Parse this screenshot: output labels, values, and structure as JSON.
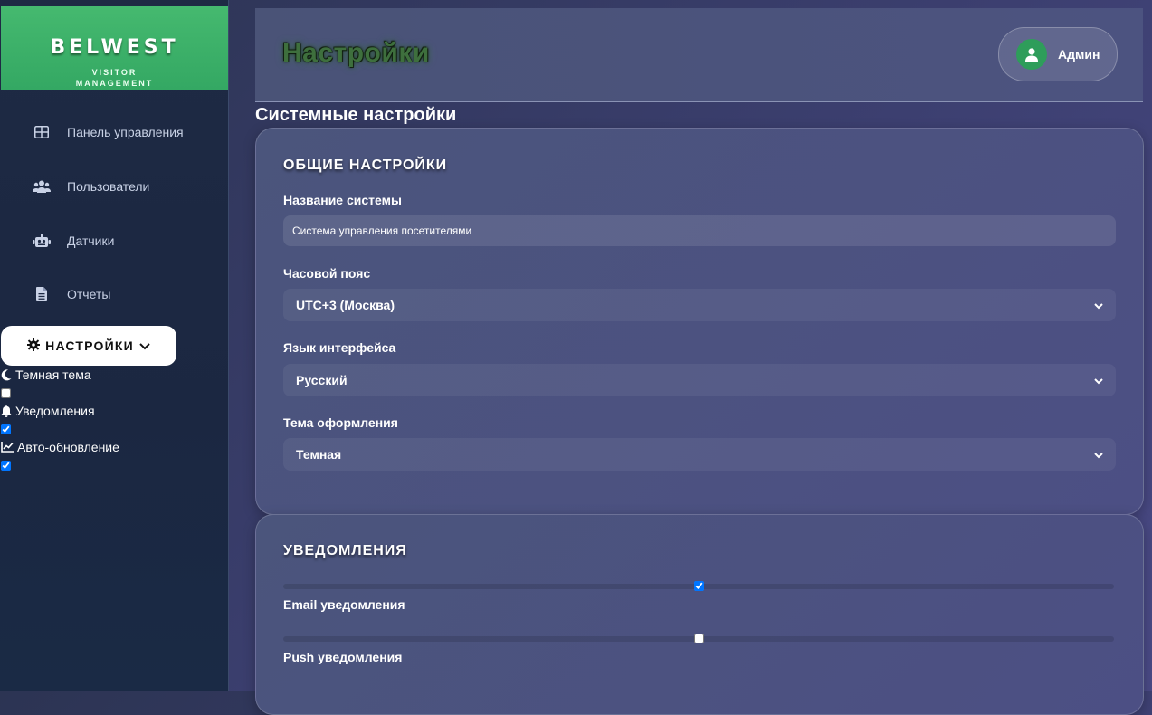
{
  "brand": {
    "title": "BELWEST",
    "sub1": "VISITOR",
    "sub2": "MANAGEMENT",
    "color": "#3fb56a"
  },
  "sidebar": {
    "items": [
      {
        "label": "Панель управления",
        "icon": "dashboard-icon"
      },
      {
        "label": "Пользователи",
        "icon": "users-icon"
      },
      {
        "label": "Датчики",
        "icon": "robot-icon"
      },
      {
        "label": "Отчеты",
        "icon": "document-icon"
      }
    ],
    "settings_label": "НАСТРОЙКИ",
    "options": [
      {
        "label": "Темная тема",
        "icon": "moon-icon",
        "checked": false
      },
      {
        "label": "Уведомления",
        "icon": "bell-icon",
        "checked": true
      },
      {
        "label": "Авто-обновление",
        "icon": "chart-line-icon",
        "checked": true
      }
    ]
  },
  "header": {
    "title": "Настройки",
    "user_name": "Админ"
  },
  "main": {
    "heading": "Системные настройки",
    "general": {
      "title": "ОБЩИЕ НАСТРОЙКИ",
      "system_name_label": "Название системы",
      "system_name_value": "Система управления посетителями",
      "timezone_label": "Часовой пояс",
      "timezone_value": "UTC+3 (Москва)",
      "language_label": "Язык интерфейса",
      "language_value": "Русский",
      "theme_label": "Тема оформления",
      "theme_value": "Темная"
    },
    "notifications": {
      "title": "УВЕДОМЛЕНИЯ",
      "email_label": "Email уведомления",
      "email_checked": true,
      "push_label": "Push уведомления",
      "push_checked": false
    }
  }
}
